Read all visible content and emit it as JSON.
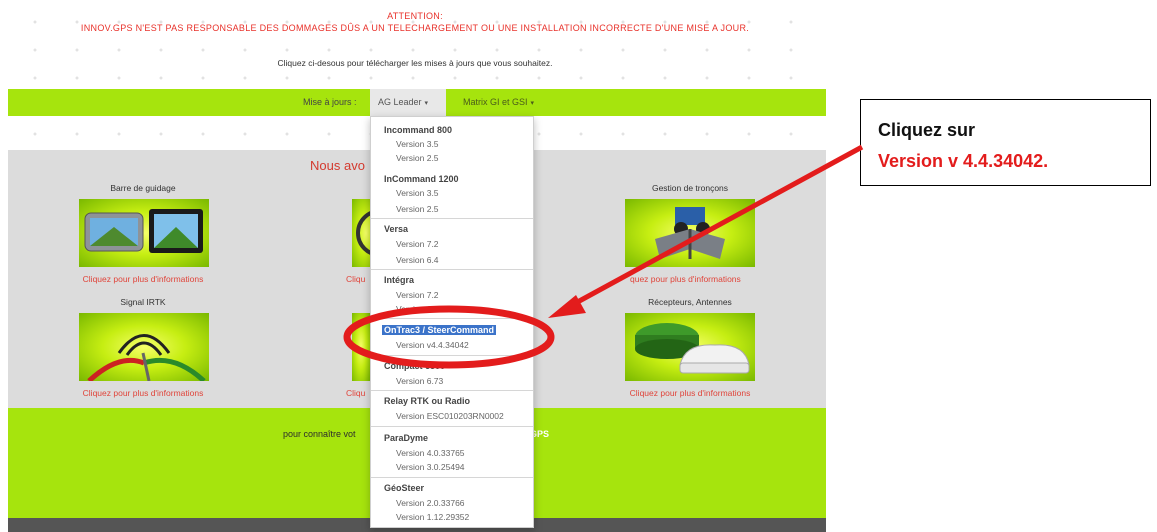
{
  "header": {
    "attention_title": "ATTENTION:",
    "attention_text": "INNOV.GPS N'EST PAS RESPONSABLE DES DOMMAGES DÛS A UN TELECHARGEMENT OU UNE INSTALLATION INCORRECTE D'UNE MISE A JOUR.",
    "subtitle": "Cliquez ci-desous pour télécharger les mises à jours que vous souhaitez."
  },
  "nav": {
    "label": "Mise à jours :",
    "menus": [
      {
        "label": "AG Leader",
        "caret": "▾"
      },
      {
        "label": "Matrix GI et GSI",
        "caret": "▾"
      }
    ]
  },
  "main": {
    "intro": "Nous avo",
    "categories": [
      {
        "title": "Barre de guidage",
        "link": "Cliquez pour plus d'informations"
      },
      {
        "title": "Gestion de tronçons",
        "link": "quez pour plus d'informations"
      },
      {
        "title": "Signal IRTK",
        "link": "Cliquez pour plus d'informations"
      },
      {
        "title": "Récepteurs, Antennes",
        "link": "Cliquez pour plus d'informations"
      }
    ],
    "partial_links": [
      "Cliqu",
      "Cliqu"
    ]
  },
  "footer": {
    "text": "pour connaître vot",
    "gps_text": "GPS"
  },
  "dropdown": {
    "groups": [
      {
        "header": "Incommand 800",
        "items": [
          "Version 3.5",
          "Version 2.5"
        ]
      },
      {
        "header": "InCommand 1200",
        "items": [
          "Version 3.5",
          "Version 2.5"
        ]
      },
      {
        "header": "Versa",
        "items": [
          "Version 7.2",
          "Version 6.4"
        ]
      },
      {
        "header": "Intégra",
        "items": [
          "Version 7.2",
          "Version 6.4"
        ]
      },
      {
        "header": "OnTrac3 / SteerCommand",
        "items": [
          "Version v4.4.34042"
        ]
      },
      {
        "header": "Compact 6500",
        "items": [
          "Version 6.73"
        ]
      },
      {
        "header": "Relay RTK ou Radio",
        "items": [
          "Version ESC010203RN0002"
        ]
      },
      {
        "header": "ParaDyme",
        "items": [
          "Version 4.0.33765",
          "Version 3.0.25494"
        ]
      },
      {
        "header": "GéoSteer",
        "items": [
          "Version 2.0.33766",
          "Version 1.12.29352"
        ]
      }
    ]
  },
  "callout": {
    "line1": "Cliquez sur",
    "line2": "Version v 4.4.34042."
  },
  "colors": {
    "lime": "#a6e40d",
    "annotation_red": "#e31c1c",
    "highlight_blue": "#3b73c9",
    "link_red": "#e0443a"
  },
  "icons": [
    "caret-down-icon",
    "guidance-bar-thumbnail",
    "section-control-thumbnail",
    "irtk-signal-thumbnail",
    "receiver-antenna-thumbnail"
  ]
}
